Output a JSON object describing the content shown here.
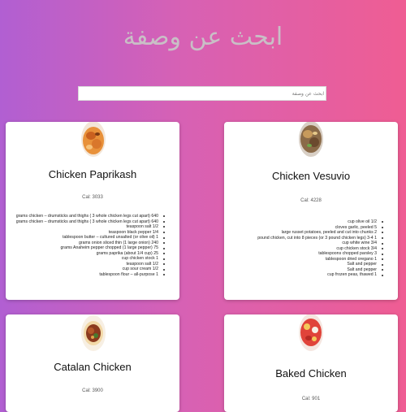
{
  "page": {
    "title": "ابحث عن وصفة",
    "search_placeholder": "ابحث عن وصفة",
    "search_value": ""
  },
  "recipes": [
    {
      "title": "Chicken Paprikash",
      "calories": "Cal: 3033",
      "image_icon": "chicken-paprikash-photo",
      "ingredients": [
        "grams chicken – drumsticks and thighs ( 3 whole chicken legs cut apart) 640",
        "grams chicken – drumsticks and thighs ( 3 whole chicken legs cut apart) 640",
        "teaspoon salt 1/2",
        "teaspoon black pepper 1/4",
        "tablespoon butter – cultured unsalted (or olive oil) 1",
        "grams onion sliced thin (1 large onion) 240",
        "grams Anaheim pepper chopped (1 large pepper) 75",
        "grams paprika (about 1/4 cup) 25",
        "cup chicken stock 1",
        "teaspoon salt 1/2",
        "cup sour cream 1/2",
        "tablespoon flour – all-purpose 1"
      ]
    },
    {
      "title": "Chicken Vesuvio",
      "calories": "Cal: 4228",
      "image_icon": "chicken-vesuvio-photo",
      "ingredients": [
        "cup olive oil 1/2",
        "cloves garlic, peeled 5",
        "large russet potatoes, peeled and cut into chunks 2",
        "pound chicken, cut into 8 pieces (or 3 pound chicken legs) 3-4 1",
        "cup white wine 3/4",
        "cup chicken stock 3/4",
        "tablespoons chopped parsley 3",
        "tablespoon dried oregano 1",
        "Salt and pepper",
        "Salt and pepper",
        "cup frozen peas, thawed 1"
      ]
    },
    {
      "title": "Catalan Chicken",
      "calories": "Cal: 3900",
      "image_icon": "catalan-chicken-photo",
      "ingredients": []
    },
    {
      "title": "Baked Chicken",
      "calories": "Cal: 901",
      "image_icon": "baked-chicken-photo",
      "ingredients": []
    }
  ]
}
